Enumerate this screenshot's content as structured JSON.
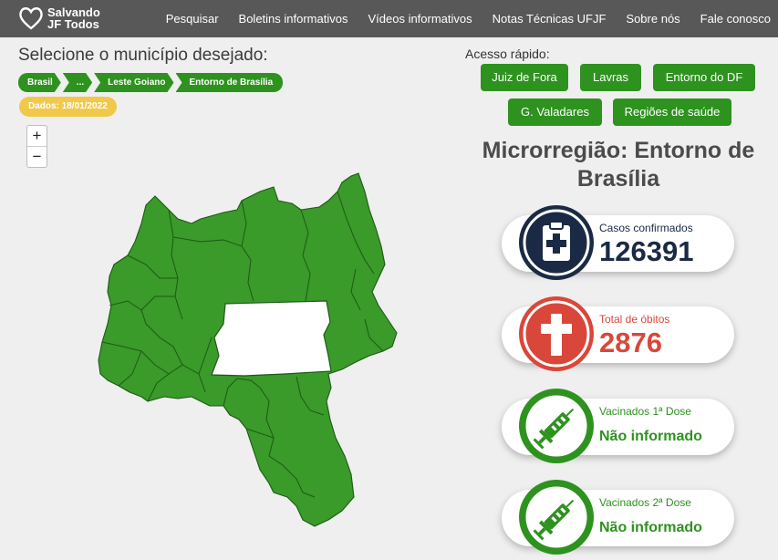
{
  "logo": {
    "line1": "Salvando",
    "line2": "JF Todos"
  },
  "nav": [
    "Pesquisar",
    "Boletins informativos",
    "Vídeos informativos",
    "Notas Técnicas UFJF",
    "Sobre nós",
    "Fale conosco"
  ],
  "page_title": "Selecione o município desejado:",
  "breadcrumb": [
    "Brasil",
    "...",
    "Leste Goiano",
    "Entorno de Brasília"
  ],
  "date_badge": "Dados: 18/01/2022",
  "zoom": {
    "in": "+",
    "out": "−"
  },
  "quick_access": {
    "label": "Acesso rápido:",
    "buttons": [
      "Juiz de Fora",
      "Lavras",
      "Entorno do DF",
      "G. Valadares",
      "Regiões de saúde"
    ]
  },
  "region_title": "Microrregião: Entorno de Brasília",
  "stats": [
    {
      "label": "Casos confirmados",
      "value": "126391",
      "color": "#1b2a44",
      "icon": "clipboard-icon"
    },
    {
      "label": "Total de óbitos",
      "value": "2876",
      "color": "#d9473a",
      "icon": "cross-icon"
    },
    {
      "label": "Vacinados 1ª Dose",
      "value": "Não informado",
      "color": "#2e921f",
      "icon": "syringe-icon"
    },
    {
      "label": "Vacinados 2ª Dose",
      "value": "Não informado",
      "color": "#2e921f",
      "icon": "syringe-icon"
    }
  ],
  "colors": {
    "header": "#585858",
    "accent_green": "#2e921f",
    "map_fill": "#3a9a2a",
    "date_yellow": "#f2c84b",
    "cases_navy": "#1b2a44",
    "deaths_red": "#d9473a"
  }
}
